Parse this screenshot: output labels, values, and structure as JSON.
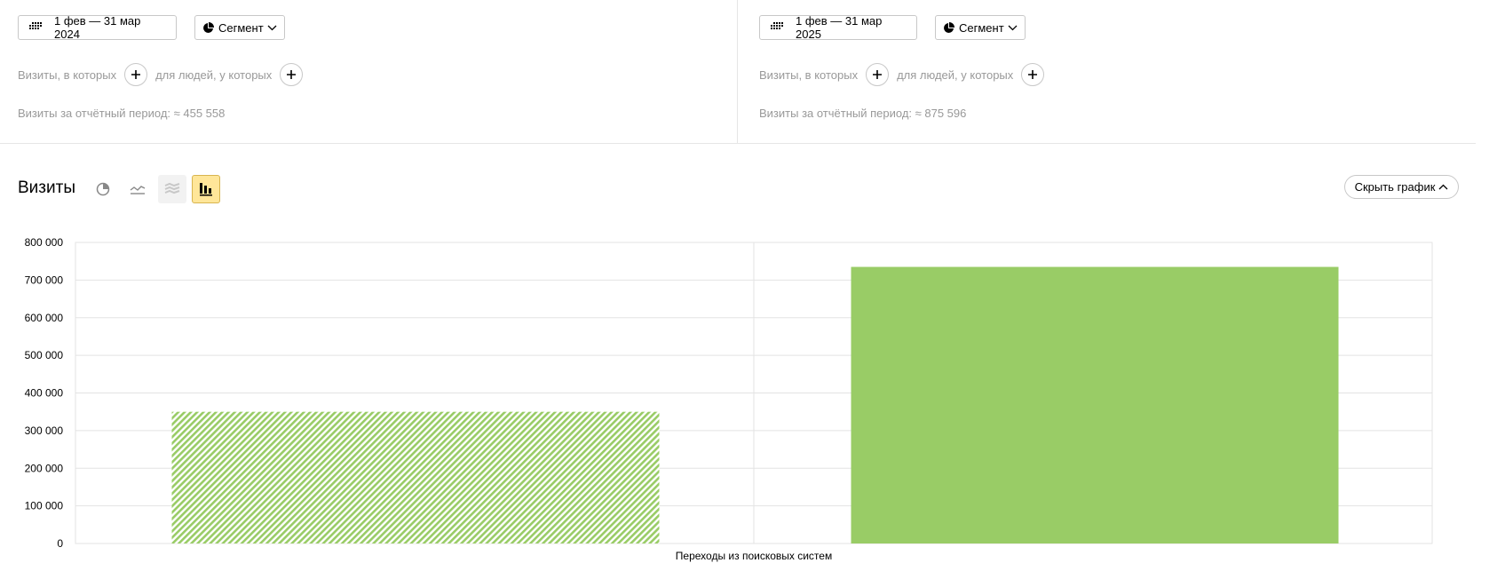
{
  "panels": [
    {
      "date_range": "1 фев — 31 мар 2024",
      "segment_label": "Сегмент",
      "filter_visits_label": "Визиты, в которых",
      "filter_people_label": "для людей, у которых",
      "visits_summary": "Визиты за отчётный период: ≈ 455 558"
    },
    {
      "date_range": "1 фев — 31 мар 2025",
      "segment_label": "Сегмент",
      "filter_visits_label": "Визиты, в которых",
      "filter_people_label": "для людей, у которых",
      "visits_summary": "Визиты за отчётный период: ≈ 875 596"
    }
  ],
  "section": {
    "title": "Визиты",
    "hide_chart_label": "Скрыть график"
  },
  "colors": {
    "bar": "#99cc66",
    "active_toggle_bg": "#ffe699",
    "muted_text": "#999999"
  },
  "chart_data": {
    "type": "bar",
    "categories": [
      "Переходы из поисковых систем"
    ],
    "series": [
      {
        "values": [
          350000
        ],
        "style": "hatched"
      },
      {
        "values": [
          735000
        ],
        "style": "solid"
      }
    ],
    "ylim": [
      0,
      800000
    ],
    "yticks": [
      "0",
      "100 000",
      "200 000",
      "300 000",
      "400 000",
      "500 000",
      "600 000",
      "700 000",
      "800 000"
    ],
    "grid": true
  }
}
